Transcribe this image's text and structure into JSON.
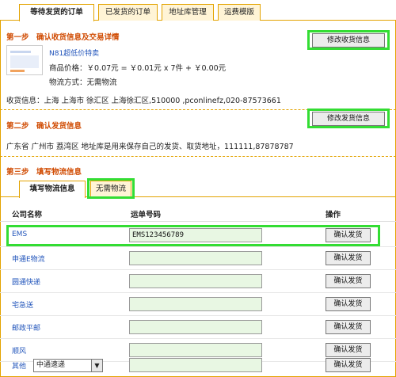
{
  "tabs": [
    "等待发货的订单",
    "已发货的订单",
    "地址库管理",
    "运费模版"
  ],
  "step1": {
    "title": "第一步　确认收货信息及交易详情",
    "button": "修改收货信息",
    "product_link": "N81超低价特卖",
    "price_line": "商品价格：￥0.07元 = ￥0.01元 x 7件 + ￥0.00元",
    "shipping_method": "物流方式：无需物流",
    "receiver": "收货信息：上海 上海市 徐汇区 上海徐汇区,510000 ,pconlinefz,020-87573661"
  },
  "step2": {
    "title": "第二步　确认发货信息",
    "button": "修改发货信息",
    "sender": "广东省 广州市 荔湾区 地址库是用来保存自己的发货、取货地址，111111,87878787"
  },
  "step3": {
    "title": "第三步　填写物流信息",
    "subtabs": [
      "填写物流信息",
      "无需物流"
    ]
  },
  "table": {
    "headers": [
      "公司名称",
      "运单号码",
      "操作"
    ],
    "confirm_label": "确认发货",
    "rows": [
      {
        "company": "EMS",
        "tracking": "EMS123456789"
      },
      {
        "company": "申通E物流",
        "tracking": ""
      },
      {
        "company": "圆通快递",
        "tracking": ""
      },
      {
        "company": "宅急送",
        "tracking": ""
      },
      {
        "company": "邮政平邮",
        "tracking": ""
      },
      {
        "company": "顺风",
        "tracking": ""
      }
    ],
    "other_label": "其他",
    "other_select": "中通速递"
  },
  "colors": {
    "highlight": "#33dd33",
    "tab_border": "#e3a300",
    "step_title": "#d04a00",
    "link": "#2255bb",
    "input_bg": "#e8f7e3"
  }
}
